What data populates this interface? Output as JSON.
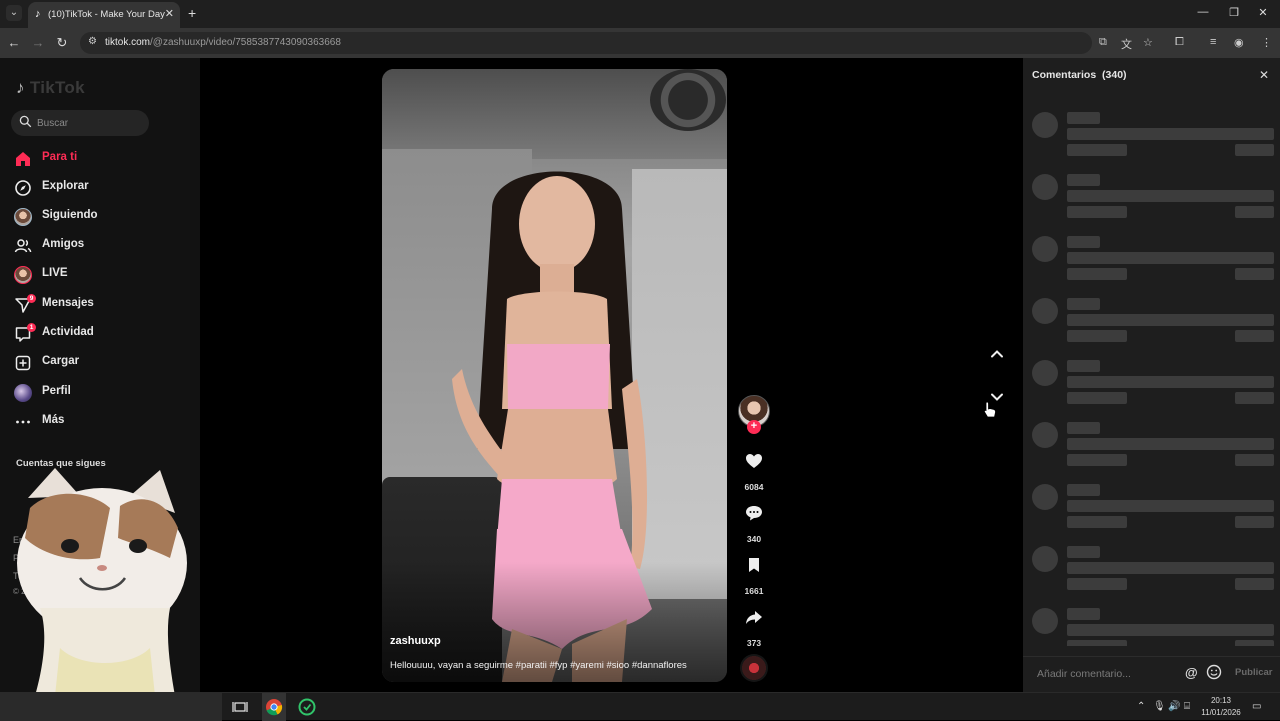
{
  "browser": {
    "tab_title": "(10)TikTok - Make Your Day",
    "url_host": "tiktok.com",
    "url_path": "/@zashuuxp/video/7585387743090363668"
  },
  "sidebar": {
    "logo": "TikTok",
    "search_placeholder": "Buscar",
    "items": [
      {
        "label": "Para ti",
        "icon": "home-icon",
        "active": true
      },
      {
        "label": "Explorar",
        "icon": "compass-icon"
      },
      {
        "label": "Siguiendo",
        "icon": "avatar-icon"
      },
      {
        "label": "Amigos",
        "icon": "friends-icon"
      },
      {
        "label": "LIVE",
        "icon": "live-avatar-icon"
      },
      {
        "label": "Mensajes",
        "icon": "send-icon",
        "badge": "9"
      },
      {
        "label": "Actividad",
        "icon": "activity-icon",
        "badge": "1"
      },
      {
        "label": "Cargar",
        "icon": "upload-icon"
      },
      {
        "label": "Perfil",
        "icon": "profile-avatar-icon"
      },
      {
        "label": "Más",
        "icon": "more-icon"
      }
    ],
    "following_title": "Cuentas que sigues",
    "footer": [
      "Empr",
      "Progra",
      "Términ",
      "© 2026 TikT"
    ]
  },
  "video": {
    "author": "zashuuxp",
    "caption": "Hellouuuu, vayan a seguirme #paratii #fyp #yaremi #sioo #dannaflores"
  },
  "actions": {
    "likes": "6084",
    "comments": "340",
    "saves": "1661",
    "shares": "373"
  },
  "comments_panel": {
    "title": "Comentarios",
    "count": "(340)",
    "input_placeholder": "Añadir comentario...",
    "publish_label": "Publicar"
  },
  "taskbar": {
    "time": "20:13",
    "date": "11/01/2026"
  },
  "colors": {
    "accent": "#fe2c55",
    "panel": "#1e1e1e",
    "sidebar": "#121212"
  }
}
